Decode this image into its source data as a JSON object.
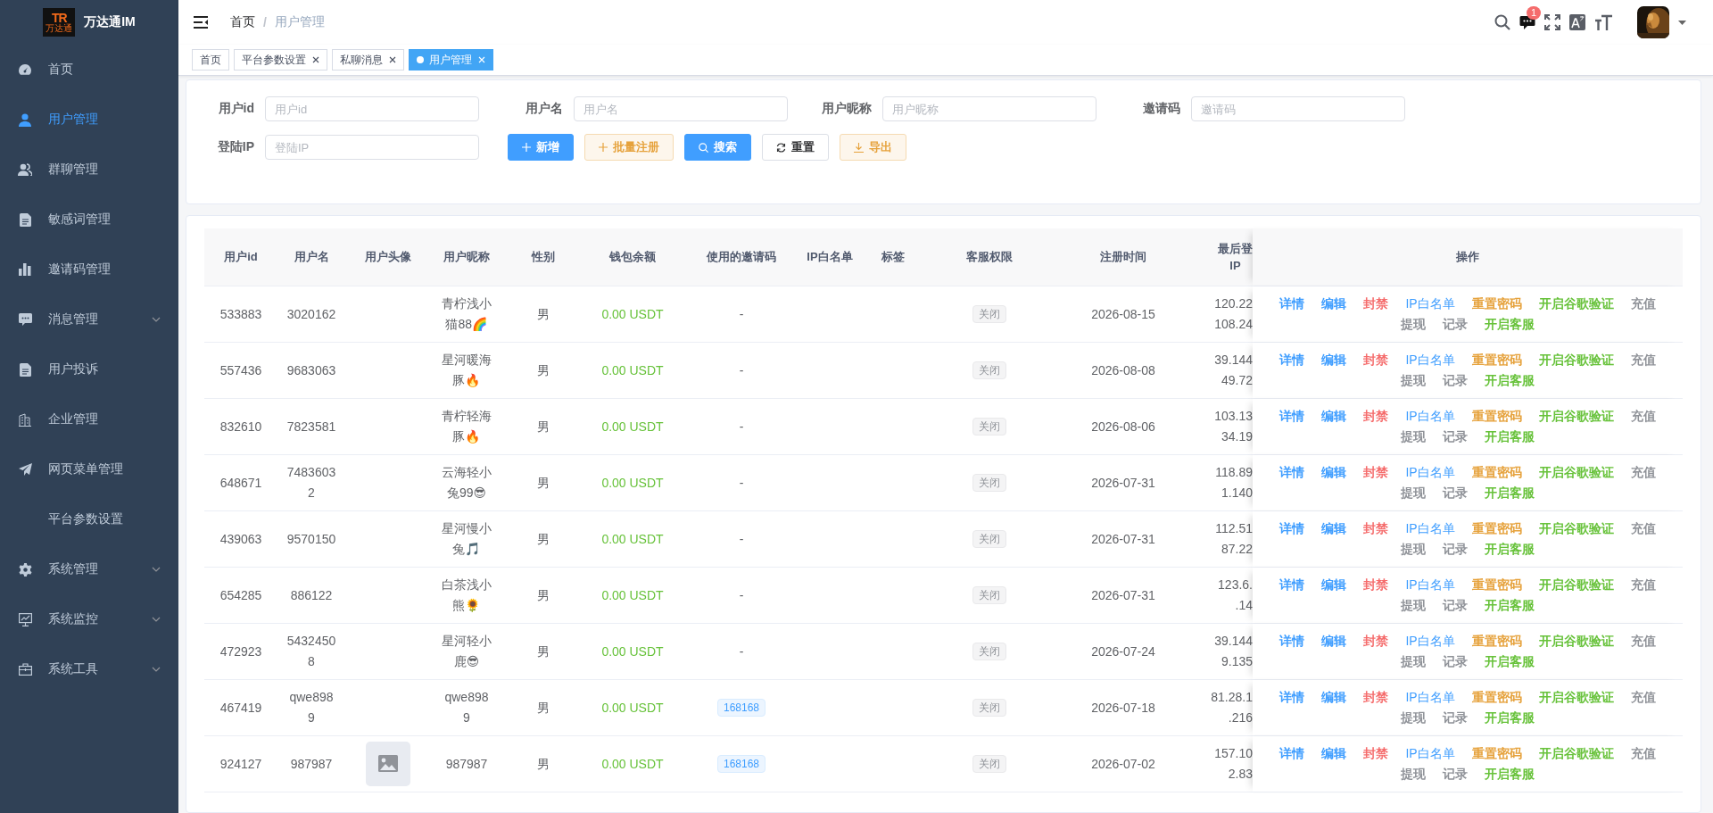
{
  "sidebar": {
    "logo_mark": "TR",
    "logo_caption": "万达通",
    "title": "万达通IM",
    "items": [
      {
        "label": "首页",
        "selected": false,
        "expandable": false
      },
      {
        "label": "用户管理",
        "selected": true,
        "expandable": false
      },
      {
        "label": "群聊管理",
        "selected": false,
        "expandable": false
      },
      {
        "label": "敏感词管理",
        "selected": false,
        "expandable": false
      },
      {
        "label": "邀请码管理",
        "selected": false,
        "expandable": false
      },
      {
        "label": "消息管理",
        "selected": false,
        "expandable": true
      },
      {
        "label": "用户投诉",
        "selected": false,
        "expandable": false
      },
      {
        "label": "企业管理",
        "selected": false,
        "expandable": false
      },
      {
        "label": "网页菜单管理",
        "selected": false,
        "expandable": false
      },
      {
        "label": "平台参数设置",
        "selected": false,
        "expandable": false
      },
      {
        "label": "系统管理",
        "selected": false,
        "expandable": true
      },
      {
        "label": "系统监控",
        "selected": false,
        "expandable": true
      },
      {
        "label": "系统工具",
        "selected": false,
        "expandable": true
      }
    ]
  },
  "header": {
    "breadcrumb": [
      {
        "label": "首页",
        "current": false
      },
      {
        "label": "用户管理",
        "current": true
      }
    ],
    "notification_count": "1",
    "breadcrumb_separator": "/"
  },
  "tabs": [
    {
      "label": "首页",
      "selected": false,
      "closable": false
    },
    {
      "label": "平台参数设置",
      "selected": false,
      "closable": true
    },
    {
      "label": "私聊消息",
      "selected": false,
      "closable": true
    },
    {
      "label": "用户管理",
      "selected": true,
      "closable": true
    }
  ],
  "search_form": {
    "fields": [
      {
        "label": "用户id",
        "placeholder": "用户id"
      },
      {
        "label": "用户名",
        "placeholder": "用户名"
      },
      {
        "label": "用户昵称",
        "placeholder": "用户昵称"
      },
      {
        "label": "邀请码",
        "placeholder": "邀请码"
      },
      {
        "label": "登陆IP",
        "placeholder": "登陆IP"
      }
    ],
    "buttons": [
      {
        "label": "新增",
        "kind": "primary"
      },
      {
        "label": "批量注册",
        "kind": "warning-plain"
      },
      {
        "label": "搜索",
        "kind": "primary"
      },
      {
        "label": "重置",
        "kind": "default"
      },
      {
        "label": "导出",
        "kind": "warning-plain"
      }
    ]
  },
  "table": {
    "columns": [
      "用户id",
      "用户名",
      "用户头像",
      "用户昵称",
      "性别",
      "钱包余额",
      "使用的邀请码",
      "IP白名单",
      "标签",
      "客服权限",
      "注册时间",
      "最后登\nIP",
      "操作"
    ],
    "rows": [
      {
        "id": "533883",
        "username": "3020162",
        "nickname": "青柠浅小猫88🌈",
        "gender": "男",
        "balance": "0.00 USDT",
        "invite_code": "-",
        "invite_tag": false,
        "service": "关闭",
        "registered": "2026-08-15",
        "last_ip": "120.22\n108.24",
        "actions": [
          {
            "label": "详情",
            "kind": "primary"
          },
          {
            "label": "编辑",
            "kind": "primary"
          },
          {
            "label": "封禁",
            "kind": "danger"
          },
          {
            "label": "IP白名单",
            "kind": "link"
          },
          {
            "label": "重置密码",
            "kind": "warning"
          },
          {
            "label": "开启谷歌验证",
            "kind": "success"
          },
          {
            "label": "充值",
            "kind": "info"
          },
          {
            "label": "提现",
            "kind": "info"
          },
          {
            "label": "记录",
            "kind": "info"
          },
          {
            "label": "开启客服",
            "kind": "success"
          }
        ]
      },
      {
        "id": "557436",
        "username": "9683063",
        "nickname": "星河暖海豚🔥",
        "gender": "男",
        "balance": "0.00 USDT",
        "invite_code": "-",
        "invite_tag": false,
        "service": "关闭",
        "registered": "2026-08-08",
        "last_ip": "39.144\n49.72",
        "actions": [
          {
            "label": "详情",
            "kind": "primary"
          },
          {
            "label": "编辑",
            "kind": "primary"
          },
          {
            "label": "封禁",
            "kind": "danger"
          },
          {
            "label": "IP白名单",
            "kind": "link"
          },
          {
            "label": "重置密码",
            "kind": "warning"
          },
          {
            "label": "开启谷歌验证",
            "kind": "success"
          },
          {
            "label": "充值",
            "kind": "info"
          },
          {
            "label": "提现",
            "kind": "info"
          },
          {
            "label": "记录",
            "kind": "info"
          },
          {
            "label": "开启客服",
            "kind": "success"
          }
        ]
      },
      {
        "id": "832610",
        "username": "7823581",
        "nickname": "青柠轻海豚🔥",
        "gender": "男",
        "balance": "0.00 USDT",
        "invite_code": "-",
        "invite_tag": false,
        "service": "关闭",
        "registered": "2026-08-06",
        "last_ip": "103.13\n34.19",
        "actions": [
          {
            "label": "详情",
            "kind": "primary"
          },
          {
            "label": "编辑",
            "kind": "primary"
          },
          {
            "label": "封禁",
            "kind": "danger"
          },
          {
            "label": "IP白名单",
            "kind": "link"
          },
          {
            "label": "重置密码",
            "kind": "warning"
          },
          {
            "label": "开启谷歌验证",
            "kind": "success"
          },
          {
            "label": "充值",
            "kind": "info"
          },
          {
            "label": "提现",
            "kind": "info"
          },
          {
            "label": "记录",
            "kind": "info"
          },
          {
            "label": "开启客服",
            "kind": "success"
          }
        ]
      },
      {
        "id": "648671",
        "username": "74836032",
        "nickname": "云海轻小兔99😎",
        "gender": "男",
        "balance": "0.00 USDT",
        "invite_code": "-",
        "invite_tag": false,
        "service": "关闭",
        "registered": "2026-07-31",
        "last_ip": "118.89\n1.140",
        "actions": [
          {
            "label": "详情",
            "kind": "primary"
          },
          {
            "label": "编辑",
            "kind": "primary"
          },
          {
            "label": "封禁",
            "kind": "danger"
          },
          {
            "label": "IP白名单",
            "kind": "link"
          },
          {
            "label": "重置密码",
            "kind": "warning"
          },
          {
            "label": "开启谷歌验证",
            "kind": "success"
          },
          {
            "label": "充值",
            "kind": "info"
          },
          {
            "label": "提现",
            "kind": "info"
          },
          {
            "label": "记录",
            "kind": "info"
          },
          {
            "label": "开启客服",
            "kind": "success"
          }
        ]
      },
      {
        "id": "439063",
        "username": "9570150",
        "nickname": "星河慢小兔🎵",
        "gender": "男",
        "balance": "0.00 USDT",
        "invite_code": "-",
        "invite_tag": false,
        "service": "关闭",
        "registered": "2026-07-31",
        "last_ip": "112.51\n87.22",
        "actions": [
          {
            "label": "详情",
            "kind": "primary"
          },
          {
            "label": "编辑",
            "kind": "primary"
          },
          {
            "label": "封禁",
            "kind": "danger"
          },
          {
            "label": "IP白名单",
            "kind": "link"
          },
          {
            "label": "重置密码",
            "kind": "warning"
          },
          {
            "label": "开启谷歌验证",
            "kind": "success"
          },
          {
            "label": "充值",
            "kind": "info"
          },
          {
            "label": "提现",
            "kind": "info"
          },
          {
            "label": "记录",
            "kind": "info"
          },
          {
            "label": "开启客服",
            "kind": "success"
          }
        ]
      },
      {
        "id": "654285",
        "username": "886122",
        "nickname": "白茶浅小熊🌻",
        "gender": "男",
        "balance": "0.00 USDT",
        "invite_code": "-",
        "invite_tag": false,
        "service": "关闭",
        "registered": "2026-07-31",
        "last_ip": "123.6.\n.14",
        "actions": [
          {
            "label": "详情",
            "kind": "primary"
          },
          {
            "label": "编辑",
            "kind": "primary"
          },
          {
            "label": "封禁",
            "kind": "danger"
          },
          {
            "label": "IP白名单",
            "kind": "link"
          },
          {
            "label": "重置密码",
            "kind": "warning"
          },
          {
            "label": "开启谷歌验证",
            "kind": "success"
          },
          {
            "label": "充值",
            "kind": "info"
          },
          {
            "label": "提现",
            "kind": "info"
          },
          {
            "label": "记录",
            "kind": "info"
          },
          {
            "label": "开启客服",
            "kind": "success"
          }
        ]
      },
      {
        "id": "472923",
        "username": "54324508",
        "nickname": "星河轻小鹿😎",
        "gender": "男",
        "balance": "0.00 USDT",
        "invite_code": "-",
        "invite_tag": false,
        "service": "关闭",
        "registered": "2026-07-24",
        "last_ip": "39.144\n9.135",
        "actions": [
          {
            "label": "详情",
            "kind": "primary"
          },
          {
            "label": "编辑",
            "kind": "primary"
          },
          {
            "label": "封禁",
            "kind": "danger"
          },
          {
            "label": "IP白名单",
            "kind": "link"
          },
          {
            "label": "重置密码",
            "kind": "warning"
          },
          {
            "label": "开启谷歌验证",
            "kind": "success"
          },
          {
            "label": "充值",
            "kind": "info"
          },
          {
            "label": "提现",
            "kind": "info"
          },
          {
            "label": "记录",
            "kind": "info"
          },
          {
            "label": "开启客服",
            "kind": "success"
          }
        ]
      },
      {
        "id": "467419",
        "username": "qwe8989",
        "nickname": "qwe8989",
        "gender": "男",
        "balance": "0.00 USDT",
        "invite_code": "168168",
        "invite_tag": true,
        "service": "关闭",
        "registered": "2026-07-18",
        "last_ip": "81.28.1\n.216",
        "actions": [
          {
            "label": "详情",
            "kind": "primary"
          },
          {
            "label": "编辑",
            "kind": "primary"
          },
          {
            "label": "封禁",
            "kind": "danger"
          },
          {
            "label": "IP白名单",
            "kind": "link"
          },
          {
            "label": "重置密码",
            "kind": "warning"
          },
          {
            "label": "开启谷歌验证",
            "kind": "success"
          },
          {
            "label": "充值",
            "kind": "info"
          },
          {
            "label": "提现",
            "kind": "info"
          },
          {
            "label": "记录",
            "kind": "info"
          },
          {
            "label": "开启客服",
            "kind": "success"
          }
        ]
      },
      {
        "id": "924127",
        "username": "987987",
        "avatar": {
          "kind": "placeholder"
        },
        "nickname": "987987",
        "gender": "男",
        "balance": "0.00 USDT",
        "invite_code": "168168",
        "invite_tag": true,
        "service": "关闭",
        "registered": "2026-07-02",
        "last_ip": "157.10\n2.83",
        "actions": [
          {
            "label": "详情",
            "kind": "primary"
          },
          {
            "label": "编辑",
            "kind": "primary"
          },
          {
            "label": "封禁",
            "kind": "danger"
          },
          {
            "label": "IP白名单",
            "kind": "link"
          },
          {
            "label": "重置密码",
            "kind": "warning"
          },
          {
            "label": "开启谷歌验证",
            "kind": "success"
          },
          {
            "label": "充值",
            "kind": "info"
          },
          {
            "label": "提现",
            "kind": "info"
          },
          {
            "label": "记录",
            "kind": "info"
          },
          {
            "label": "开启客服",
            "kind": "success"
          }
        ]
      }
    ]
  }
}
